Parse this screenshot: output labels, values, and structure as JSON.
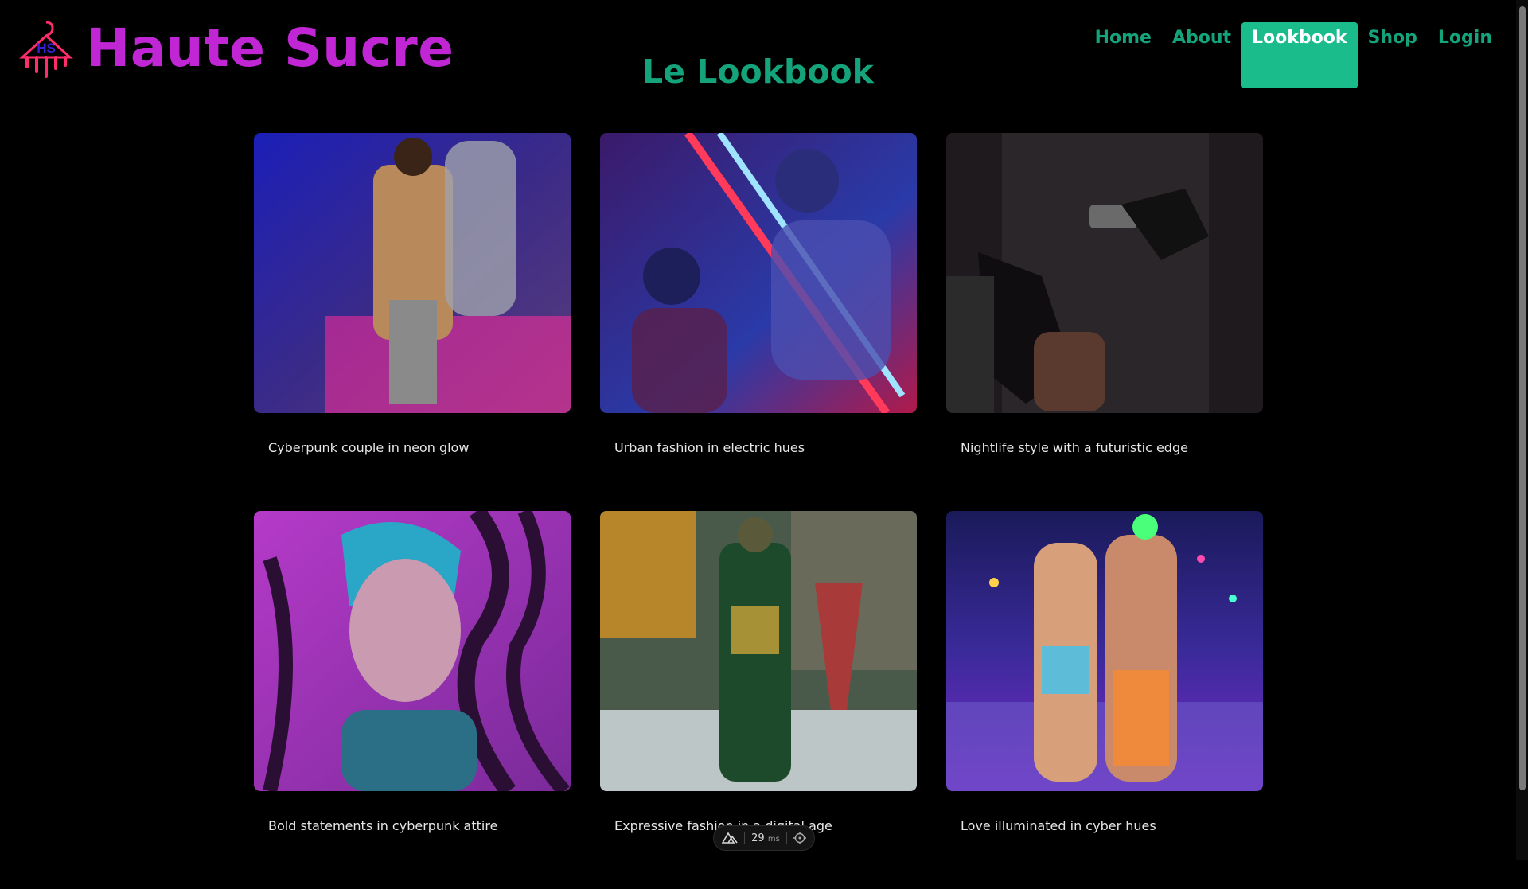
{
  "header": {
    "logo_text": "HS",
    "brand_name": "Haute Sucre",
    "page_title": "Le Lookbook"
  },
  "nav": {
    "items": [
      {
        "label": "Home",
        "active": false
      },
      {
        "label": "About",
        "active": false
      },
      {
        "label": "Lookbook",
        "active": true
      },
      {
        "label": "Shop",
        "active": false
      },
      {
        "label": "Login",
        "active": false
      }
    ]
  },
  "gallery": {
    "items": [
      {
        "caption": "Cyberpunk couple in neon glow"
      },
      {
        "caption": "Urban fashion in electric hues"
      },
      {
        "caption": "Nightlife style with a futuristic edge"
      },
      {
        "caption": "Bold statements in cyberpunk attire"
      },
      {
        "caption": "Expressive fashion in a digital age"
      },
      {
        "caption": "Love illuminated in cyber hues"
      }
    ]
  },
  "dev_badge": {
    "icon": "triangle-logo-icon",
    "timing": "29",
    "unit": "ms",
    "settings_icon": "crosshair-icon"
  },
  "colors": {
    "brand": "#c026d3",
    "accent": "#1abc8c",
    "nav_text": "#14a37a",
    "background": "#000000"
  }
}
